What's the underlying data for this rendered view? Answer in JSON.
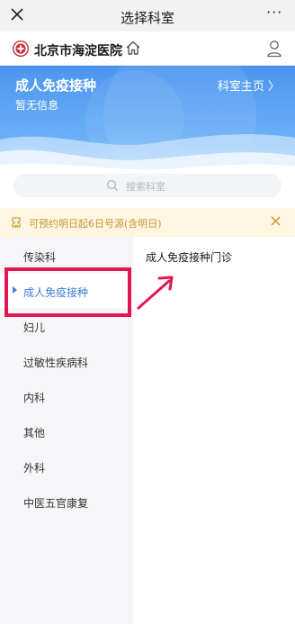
{
  "topbar": {
    "title": "选择科室",
    "more": "···"
  },
  "hospital": {
    "name": "北京市海淀医院"
  },
  "department": {
    "name": "成人免疫接种",
    "info": "暂无信息",
    "home_link": "科室主页 〉"
  },
  "search": {
    "placeholder": "搜索科室"
  },
  "notice": {
    "text": "可预约明日起6日号源(含明日)"
  },
  "sidebar": {
    "items": [
      {
        "label": "传染科",
        "active": false
      },
      {
        "label": "成人免疫接种",
        "active": true
      },
      {
        "label": "妇儿",
        "active": false
      },
      {
        "label": "过敏性疾病科",
        "active": false
      },
      {
        "label": "内科",
        "active": false
      },
      {
        "label": "其他",
        "active": false
      },
      {
        "label": "外科",
        "active": false
      },
      {
        "label": "中医五官康复",
        "active": false
      }
    ]
  },
  "clinics": [
    {
      "label": "成人免疫接种门诊"
    }
  ],
  "colors": {
    "accent": "#3d7fd9",
    "banner": "#4b95ef",
    "notice_bg": "#fdf6e0",
    "notice_text": "#c7973a",
    "annotation": "#e0184f"
  }
}
